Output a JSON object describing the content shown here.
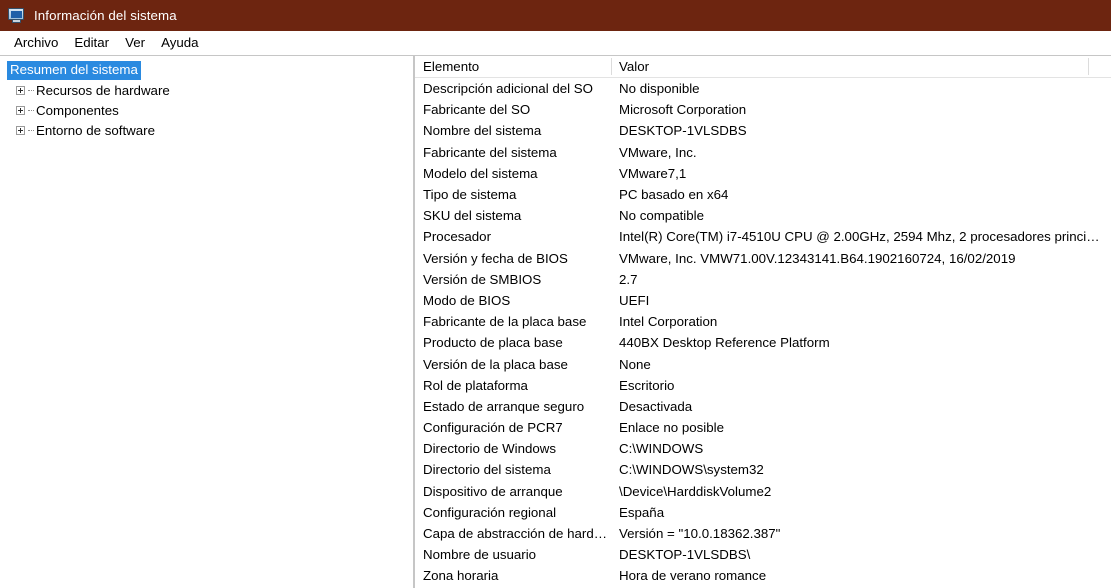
{
  "window": {
    "title": "Información del sistema",
    "icon": "computer-icon",
    "titlebar_color": "#6d2510",
    "selection_color": "#2a8ae0"
  },
  "menubar": {
    "items": [
      {
        "label": "Archivo"
      },
      {
        "label": "Editar"
      },
      {
        "label": "Ver"
      },
      {
        "label": "Ayuda"
      }
    ]
  },
  "tree": {
    "root": {
      "label": "Resumen del sistema",
      "selected": true
    },
    "nodes": [
      {
        "label": "Recursos de hardware",
        "expanded": false
      },
      {
        "label": "Componentes",
        "expanded": false
      },
      {
        "label": "Entorno de software",
        "expanded": false
      }
    ]
  },
  "list": {
    "columns": [
      {
        "label": "Elemento"
      },
      {
        "label": "Valor"
      }
    ],
    "rows": [
      {
        "item": "Descripción adicional del SO",
        "value": "No disponible"
      },
      {
        "item": "Fabricante del SO",
        "value": "Microsoft Corporation"
      },
      {
        "item": "Nombre del sistema",
        "value": "DESKTOP-1VLSDBS"
      },
      {
        "item": "Fabricante del sistema",
        "value": "VMware, Inc."
      },
      {
        "item": "Modelo del sistema",
        "value": "VMware7,1"
      },
      {
        "item": "Tipo de sistema",
        "value": "PC basado en x64"
      },
      {
        "item": "SKU del sistema",
        "value": "No compatible"
      },
      {
        "item": "Procesador",
        "value": "Intel(R) Core(TM) i7-4510U CPU @ 2.00GHz, 2594 Mhz, 2 procesadores princi…"
      },
      {
        "item": "Versión y fecha de BIOS",
        "value": "VMware, Inc. VMW71.00V.12343141.B64.1902160724, 16/02/2019"
      },
      {
        "item": "Versión de SMBIOS",
        "value": "2.7"
      },
      {
        "item": "Modo de BIOS",
        "value": "UEFI"
      },
      {
        "item": "Fabricante de la placa base",
        "value": "Intel Corporation"
      },
      {
        "item": "Producto de placa base",
        "value": "440BX Desktop Reference Platform"
      },
      {
        "item": "Versión de la placa base",
        "value": "None"
      },
      {
        "item": "Rol de plataforma",
        "value": "Escritorio"
      },
      {
        "item": "Estado de arranque seguro",
        "value": "Desactivada"
      },
      {
        "item": "Configuración de PCR7",
        "value": "Enlace no posible"
      },
      {
        "item": "Directorio de Windows",
        "value": "C:\\WINDOWS"
      },
      {
        "item": "Directorio del sistema",
        "value": "C:\\WINDOWS\\system32"
      },
      {
        "item": "Dispositivo de arranque",
        "value": "\\Device\\HarddiskVolume2"
      },
      {
        "item": "Configuración regional",
        "value": "España"
      },
      {
        "item": "Capa de abstracción de hardw…",
        "value": "Versión = \"10.0.18362.387\""
      },
      {
        "item": "Nombre de usuario",
        "value": "DESKTOP-1VLSDBS\\"
      },
      {
        "item": "Zona horaria",
        "value": "Hora de verano romance"
      }
    ]
  }
}
